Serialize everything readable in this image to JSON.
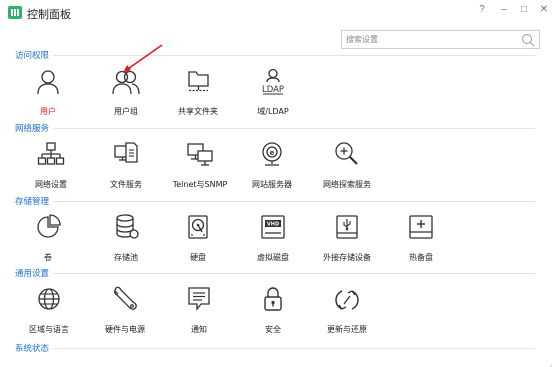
{
  "window": {
    "title": "控制面板",
    "help_glyph": "?",
    "minimize_glyph": "–",
    "maximize_glyph": "□",
    "close_glyph": "✕"
  },
  "search": {
    "placeholder": "搜索设置"
  },
  "colors": {
    "section": "#1e6fd3",
    "active": "#e0191e",
    "brand": "#2fb36a"
  },
  "sections": [
    {
      "label": "访问权限",
      "items": [
        {
          "label": "用户",
          "icon": "user-icon",
          "active": true
        },
        {
          "label": "用户组",
          "icon": "user-group-icon"
        },
        {
          "label": "共享文件夹",
          "icon": "shared-folder-icon"
        },
        {
          "label": "域/LDAP",
          "icon": "ldap-icon",
          "icon_text": "LDAP"
        }
      ]
    },
    {
      "label": "网络服务",
      "items": [
        {
          "label": "网络设置",
          "icon": "network-icon"
        },
        {
          "label": "文件服务",
          "icon": "file-service-icon"
        },
        {
          "label": "Telnet与SNMP",
          "icon": "telnet-snmp-icon"
        },
        {
          "label": "网站服务器",
          "icon": "web-server-icon"
        },
        {
          "label": "网络探索服务",
          "icon": "network-discovery-icon"
        }
      ]
    },
    {
      "label": "存储管理",
      "items": [
        {
          "label": "卷",
          "icon": "volume-icon"
        },
        {
          "label": "存储池",
          "icon": "storage-pool-icon"
        },
        {
          "label": "硬盘",
          "icon": "hard-disk-icon"
        },
        {
          "label": "虚拟磁盘",
          "icon": "virtual-disk-icon",
          "icon_text": "VHD"
        },
        {
          "label": "外接存储设备",
          "icon": "external-storage-icon"
        },
        {
          "label": "热备盘",
          "icon": "hot-spare-icon"
        }
      ]
    },
    {
      "label": "通用设置",
      "items": [
        {
          "label": "区域与语言",
          "icon": "globe-icon"
        },
        {
          "label": "硬件与电源",
          "icon": "hardware-power-icon"
        },
        {
          "label": "通知",
          "icon": "notification-icon"
        },
        {
          "label": "安全",
          "icon": "lock-icon"
        },
        {
          "label": "更新与还原",
          "icon": "update-restore-icon"
        }
      ]
    },
    {
      "label": "系统状态",
      "items": []
    }
  ]
}
